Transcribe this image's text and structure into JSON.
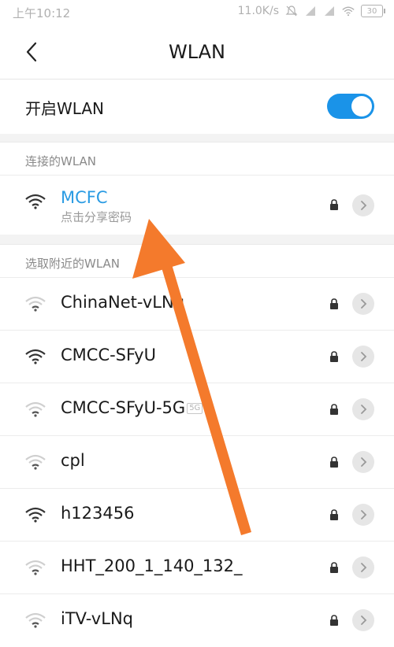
{
  "status_bar": {
    "time": "上午10:12",
    "net_speed": "11.0K/s",
    "battery": "30"
  },
  "header": {
    "title": "WLAN",
    "back_icon": "chevron-left-icon"
  },
  "toggle": {
    "label": "开启WLAN",
    "state": "on",
    "accent_color": "#1a93e8"
  },
  "connected_section": {
    "label": "连接的WLAN",
    "network": {
      "name": "MCFC",
      "subtitle": "点击分享密码",
      "color": "#2a9be3"
    }
  },
  "nearby_section": {
    "label": "选取附近的WLAN",
    "networks": [
      {
        "name": "ChinaNet-vLNq",
        "badge": "",
        "signal": "weak"
      },
      {
        "name": "CMCC-SFyU",
        "badge": "",
        "signal": "strong"
      },
      {
        "name": "CMCC-SFyU-5G",
        "badge": "5G",
        "signal": "weak"
      },
      {
        "name": "cpl",
        "badge": "",
        "signal": "weak"
      },
      {
        "name": "h123456",
        "badge": "",
        "signal": "strong"
      },
      {
        "name": "HHT_200_1_140_132_",
        "badge": "",
        "signal": "weak"
      },
      {
        "name": "iTV-vLNq",
        "badge": "",
        "signal": "weak"
      }
    ]
  },
  "annotation": {
    "icon": "arrow-annotation",
    "color": "#f47a2c"
  }
}
